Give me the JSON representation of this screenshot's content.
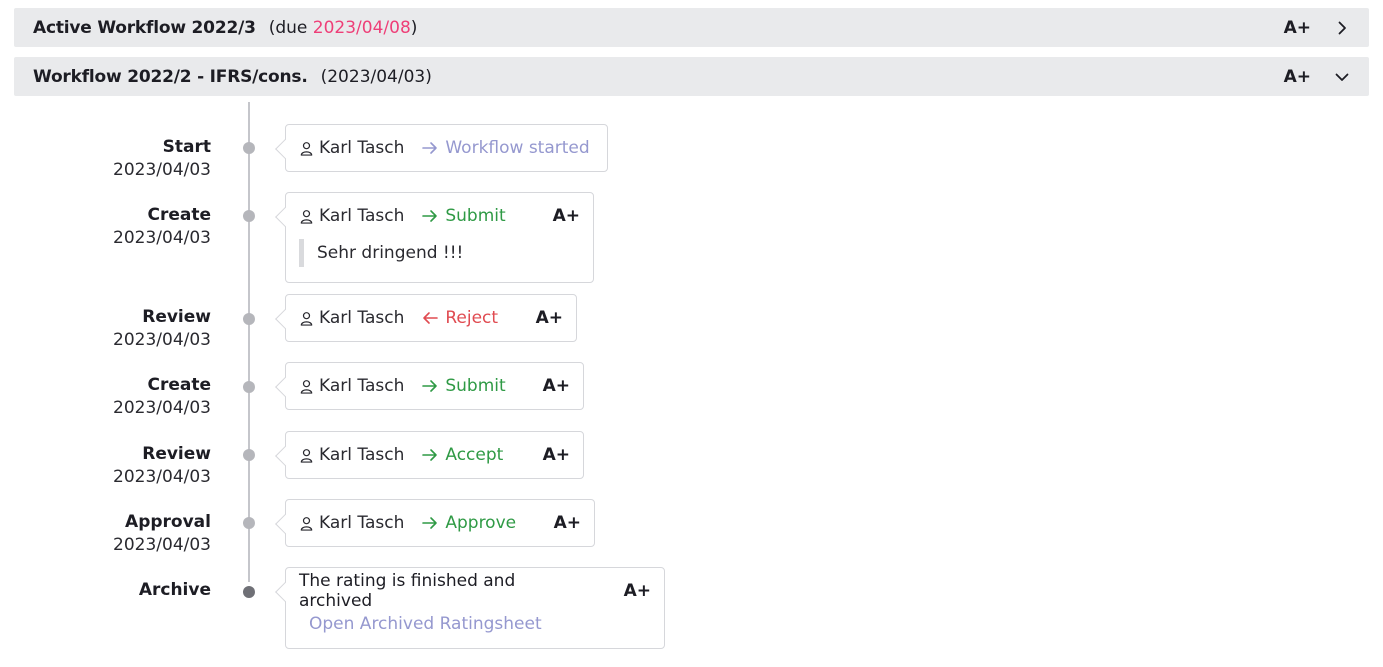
{
  "workflows": [
    {
      "title": "Active Workflow 2022/3",
      "meta_prefix": "(due ",
      "due_date": "2023/04/08",
      "meta_suffix": ")",
      "grade": "A+",
      "chevron": "chevron-right-icon"
    },
    {
      "title": "Workflow 2022/2 - IFRS/cons.",
      "meta": "(2023/04/03)",
      "grade": "A+",
      "chevron": "chevron-down-icon"
    }
  ],
  "steps": [
    {
      "name": "Start",
      "date": "2023/04/03",
      "user": "Karl Tasch",
      "action": "Workflow started",
      "action_icon": "arrow-right-icon",
      "grade": ""
    },
    {
      "name": "Create",
      "date": "2023/04/03",
      "user": "Karl Tasch",
      "action": "Submit",
      "action_icon": "arrow-right-icon",
      "grade": "A+",
      "comment": "Sehr dringend !!!"
    },
    {
      "name": "Review",
      "date": "2023/04/03",
      "user": "Karl Tasch",
      "action": "Reject",
      "action_icon": "arrow-left-icon",
      "grade": "A+"
    },
    {
      "name": "Create",
      "date": "2023/04/03",
      "user": "Karl Tasch",
      "action": "Submit",
      "action_icon": "arrow-right-icon",
      "grade": "A+"
    },
    {
      "name": "Review",
      "date": "2023/04/03",
      "user": "Karl Tasch",
      "action": "Accept",
      "action_icon": "arrow-right-icon",
      "grade": "A+"
    },
    {
      "name": "Approval",
      "date": "2023/04/03",
      "user": "Karl Tasch",
      "action": "Approve",
      "action_icon": "arrow-right-icon",
      "grade": "A+"
    },
    {
      "name": "Archive",
      "message": "The rating is finished and archived",
      "grade": "A+",
      "link": "Open Archived Ratingsheet"
    }
  ],
  "colors": {
    "due_date": "#ee3f78",
    "action_started": "#9598cf",
    "action_positive": "#2f9a45",
    "action_negative": "#e04b51",
    "link": "#9598cf",
    "header_bg": "#e9eaec"
  }
}
